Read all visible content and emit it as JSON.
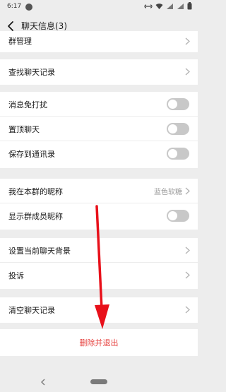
{
  "status_bar": {
    "time": "6:17",
    "icons": [
      "link-icon",
      "wifi-icon",
      "signal-icon",
      "battery-icon"
    ]
  },
  "nav": {
    "title": "聊天信息(3)"
  },
  "sections": {
    "group_manage": {
      "label": "群管理"
    },
    "search_history": {
      "label": "查找聊天记录"
    },
    "mute": {
      "label": "消息免打扰",
      "on": false
    },
    "pin": {
      "label": "置顶聊天",
      "on": false
    },
    "save_contacts": {
      "label": "保存到通讯录",
      "on": false
    },
    "my_nickname": {
      "label": "我在本群的昵称",
      "value": "蓝色软糖"
    },
    "show_nicknames": {
      "label": "显示群成员昵称",
      "on": false
    },
    "background": {
      "label": "设置当前聊天背景"
    },
    "report": {
      "label": "投诉"
    },
    "clear_history": {
      "label": "清空聊天记录"
    }
  },
  "danger": {
    "label": "删除并退出"
  },
  "colors": {
    "danger": "#e64340",
    "background": "#ededed",
    "toggle_off": "#c8c8c8",
    "arrow": "#e8101a"
  }
}
